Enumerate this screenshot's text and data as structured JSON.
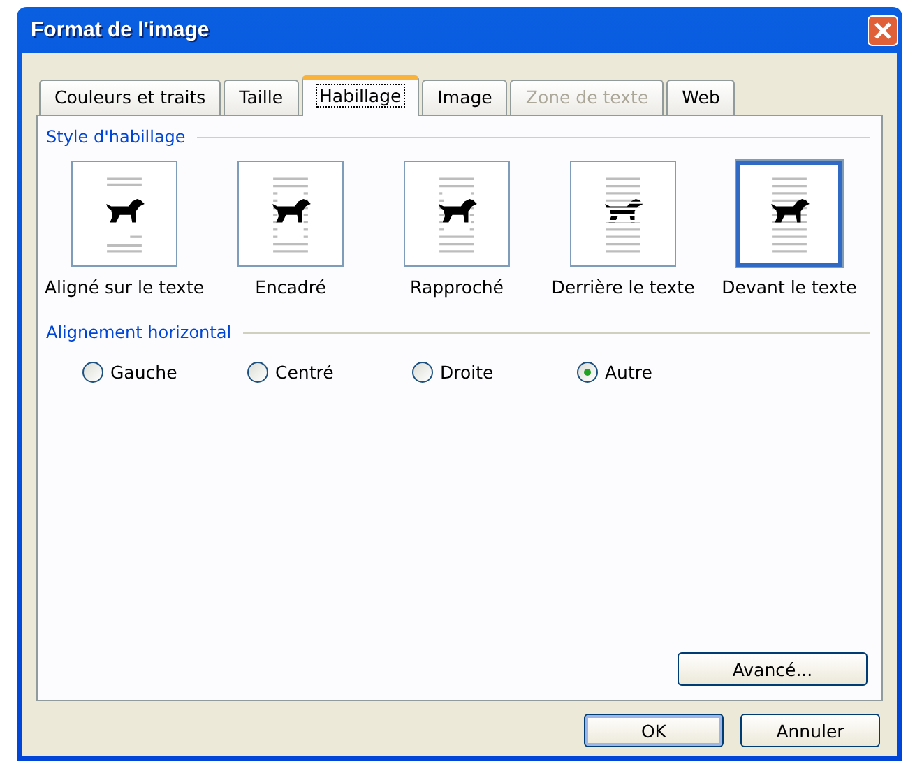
{
  "window": {
    "title": "Format de l'image"
  },
  "tabs": [
    {
      "label": "Couleurs et traits",
      "selected": false,
      "disabled": false
    },
    {
      "label": "Taille",
      "selected": false,
      "disabled": false
    },
    {
      "label": "Habillage",
      "selected": true,
      "disabled": false
    },
    {
      "label": "Image",
      "selected": false,
      "disabled": false
    },
    {
      "label": "Zone de texte",
      "selected": false,
      "disabled": true
    },
    {
      "label": "Web",
      "selected": false,
      "disabled": false
    }
  ],
  "wrap_style": {
    "heading": "Style d'habillage",
    "options": [
      {
        "label": "Aligné sur le texte",
        "kind": "inline",
        "selected": false
      },
      {
        "label": "Encadré",
        "kind": "square",
        "selected": false
      },
      {
        "label": "Rapproché",
        "kind": "tight",
        "selected": false
      },
      {
        "label": "Derrière le texte",
        "kind": "behind",
        "selected": false
      },
      {
        "label": "Devant le texte",
        "kind": "front",
        "selected": true
      }
    ]
  },
  "horizontal_alignment": {
    "heading": "Alignement horizontal",
    "options": [
      {
        "label": "Gauche",
        "selected": false
      },
      {
        "label": "Centré",
        "selected": false
      },
      {
        "label": "Droite",
        "selected": false
      },
      {
        "label": "Autre",
        "selected": true
      }
    ]
  },
  "advanced_button": "Avancé...",
  "buttons": [
    {
      "label": "OK",
      "kind": "default"
    },
    {
      "label": "Annuler",
      "kind": "normal"
    }
  ]
}
